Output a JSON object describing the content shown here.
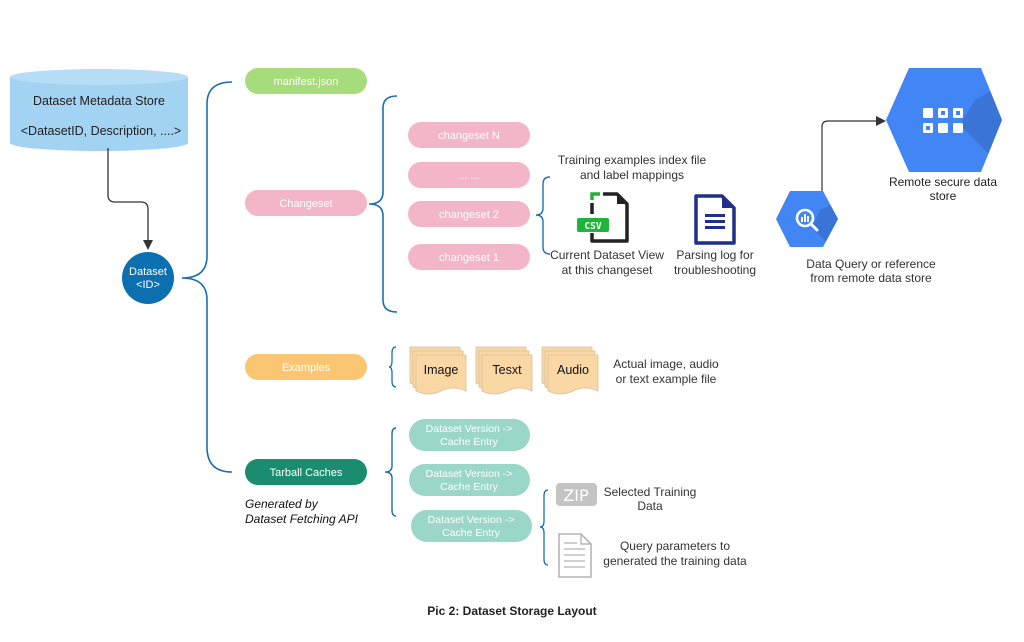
{
  "caption": "Pic 2: Dataset Storage Layout",
  "colors": {
    "bracket": "#1a6fb3",
    "metadata_store": "#a3d3f3",
    "dataset_node": "#0b6fb0",
    "manifest": "#a6dc7b",
    "changeset": "#f3b5c8",
    "examples": "#fbc673",
    "tarball": "#1a8c6f",
    "cache_entry": "#9ad7c8",
    "example_file": "#fad8a6",
    "gcp_blue": "#4285f4",
    "gcp_shadow": "#3a6fd0",
    "csv_green": "#1fb53a",
    "log_navy": "#1f2f8a",
    "gray_icon": "#bdbdbd"
  },
  "metadata_store": {
    "title": "Dataset Metadata Store",
    "fields": "<DatasetID, Description, ....>"
  },
  "dataset_node": {
    "line1": "Dataset",
    "line2": "<ID>"
  },
  "manifest": {
    "label": "manifest.json"
  },
  "changeset": {
    "label": "Changeset",
    "items": [
      "changeset N",
      "... ...",
      "changeset 2",
      "changeset 1"
    ],
    "index_note": [
      "Training examples index file",
      "and label mappings"
    ],
    "csv_icon_label": "CSV",
    "csv_caption": [
      "Current Dataset View",
      "at this changeset"
    ],
    "log_caption": [
      "Parsing log for",
      "troubleshooting"
    ]
  },
  "remote": {
    "query_caption": [
      "Data Query or reference",
      "from remote data store"
    ],
    "store_caption": [
      "Remote secure data",
      "store"
    ]
  },
  "examples": {
    "label": "Examples",
    "files": [
      "Image",
      "Tesxt",
      "Audio"
    ],
    "caption": [
      "Actual image, audio",
      "or text example file"
    ]
  },
  "tarball": {
    "label": "Tarball Caches",
    "note": [
      "Generated by",
      "Dataset Fetching API"
    ],
    "entries": [
      [
        "Dataset Version ->",
        "Cache Entry"
      ],
      [
        "Dataset Version ->",
        "Cache Entry"
      ],
      [
        "Dataset Version ->",
        "Cache Entry"
      ]
    ],
    "zip_icon_label": "ZIP",
    "zip_caption": [
      "Selected Training",
      "Data"
    ],
    "params_caption": [
      "Query parameters to",
      "generated the training data"
    ]
  }
}
